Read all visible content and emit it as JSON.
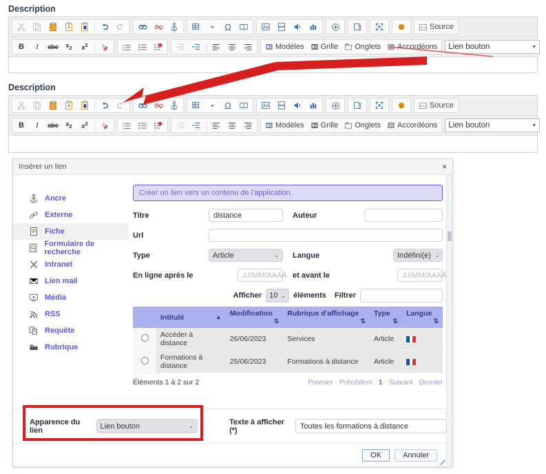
{
  "editors": [
    {
      "label": "Description"
    },
    {
      "label": "Description"
    }
  ],
  "toolbar": {
    "groups_row1": [
      {
        "icons": [
          {
            "name": "cut-icon",
            "glyph": "✂",
            "state": "dim"
          },
          {
            "name": "copy-icon",
            "glyph": "⧉",
            "state": "dim"
          },
          {
            "name": "paste-icon",
            "glyph": "📋",
            "state": "on"
          },
          {
            "name": "paste-text-icon",
            "glyph": "A",
            "state": "on"
          },
          {
            "name": "paste-word-icon",
            "glyph": "W",
            "state": "on"
          },
          {
            "name": "separator",
            "glyph": "|",
            "state": "sep"
          },
          {
            "name": "undo-icon",
            "glyph": "↺",
            "state": "on"
          },
          {
            "name": "redo-icon",
            "glyph": "↻",
            "state": "dim"
          }
        ]
      },
      {
        "icons": [
          {
            "name": "link-icon",
            "glyph": "🔗",
            "state": "on"
          },
          {
            "name": "unlink-icon",
            "glyph": "⛓",
            "state": "red"
          },
          {
            "name": "anchor-icon",
            "glyph": "⚓",
            "state": "on"
          }
        ]
      },
      {
        "icons": [
          {
            "name": "table-icon",
            "glyph": "▦",
            "state": "on"
          },
          {
            "name": "special-char-icon",
            "glyph": "Ω",
            "state": "on"
          },
          {
            "name": "page-break-icon",
            "glyph": "📖",
            "state": "on"
          }
        ]
      },
      {
        "icons": [
          {
            "name": "image-icon",
            "glyph": "🖼",
            "state": "on"
          },
          {
            "name": "media-icon",
            "glyph": "🎞",
            "state": "on"
          },
          {
            "name": "audio-icon",
            "glyph": "🔊",
            "state": "on"
          },
          {
            "name": "chart-icon",
            "glyph": "📊",
            "state": "on"
          }
        ]
      },
      {
        "icons": [
          {
            "name": "insert-plus-icon",
            "glyph": "(+)",
            "state": "on"
          }
        ]
      },
      {
        "icons": [
          {
            "name": "document-icon",
            "glyph": "🗐",
            "state": "on"
          }
        ]
      },
      {
        "icons": [
          {
            "name": "maximize-icon",
            "glyph": "⤢",
            "state": "on"
          }
        ]
      },
      {
        "icons": [
          {
            "name": "smiley-icon",
            "glyph": "☺",
            "state": "on"
          }
        ]
      },
      {
        "icons": [
          {
            "name": "source-icon",
            "glyph": "</>",
            "state": "on",
            "label": "Source"
          }
        ]
      }
    ],
    "source_label": "Source",
    "groups_row2": [
      {
        "icons": [
          {
            "name": "bold-icon",
            "glyph": "B",
            "state": "on"
          },
          {
            "name": "italic-icon",
            "glyph": "I",
            "state": "on"
          },
          {
            "name": "strikethrough-icon",
            "glyph": "abc",
            "state": "on"
          },
          {
            "name": "subscript-icon",
            "glyph": "x₂",
            "state": "on"
          },
          {
            "name": "superscript-icon",
            "glyph": "x²",
            "state": "on"
          },
          {
            "name": "separator",
            "glyph": "|",
            "state": "sep"
          },
          {
            "name": "remove-format-icon",
            "glyph": "🧹",
            "state": "red"
          }
        ]
      },
      {
        "icons": [
          {
            "name": "numbered-list-icon",
            "glyph": "1≡",
            "state": "on"
          },
          {
            "name": "bulleted-list-icon",
            "glyph": "•≡",
            "state": "on"
          },
          {
            "name": "todo-list-icon",
            "glyph": "☑≡",
            "state": "on"
          }
        ]
      },
      {
        "icons": [
          {
            "name": "outdent-icon",
            "glyph": "⇤",
            "state": "dim"
          },
          {
            "name": "indent-icon",
            "glyph": "⇥",
            "state": "on"
          },
          {
            "name": "separator",
            "glyph": "|",
            "state": "sep"
          },
          {
            "name": "align-left-icon",
            "glyph": "≡",
            "state": "on"
          },
          {
            "name": "align-center-icon",
            "glyph": "≡",
            "state": "on"
          },
          {
            "name": "align-right-icon",
            "glyph": "≡",
            "state": "on"
          }
        ]
      }
    ],
    "text_buttons": [
      {
        "name": "templates-button",
        "icon": "templates-icon",
        "label": "Modèles"
      },
      {
        "name": "grid-button",
        "icon": "grid-icon",
        "label": "Grille"
      },
      {
        "name": "tabs-button",
        "icon": "tabs-icon",
        "label": "Onglets"
      },
      {
        "name": "accordions-button",
        "icon": "accordions-icon",
        "label": "Accordéons"
      }
    ],
    "style_select": "Lien bouton",
    "quote_icon": "❞"
  },
  "dialog": {
    "title": "Insérer un lien",
    "close_label": "×",
    "sidebar": [
      {
        "icon": "anchor-icon",
        "label": "Ancre",
        "active": false
      },
      {
        "icon": "external-link-icon",
        "label": "Externe",
        "active": false
      },
      {
        "icon": "file-icon",
        "label": "Fiche",
        "active": true
      },
      {
        "icon": "search-form-icon",
        "label": "Formulaire de recherche",
        "active": false
      },
      {
        "icon": "intranet-icon",
        "label": "Intranet",
        "active": false
      },
      {
        "icon": "mail-icon",
        "label": "Lien mail",
        "active": false
      },
      {
        "icon": "media-icon",
        "label": "Média",
        "active": false
      },
      {
        "icon": "rss-icon",
        "label": "RSS",
        "active": false
      },
      {
        "icon": "query-icon",
        "label": "Requête",
        "active": false
      },
      {
        "icon": "folder-icon",
        "label": "Rubrique",
        "active": false
      }
    ],
    "alert": "Créer un lien vers un contenu de l'application.",
    "form": {
      "titre_label": "Titre",
      "titre_value": "distance",
      "auteur_label": "Auteur",
      "auteur_value": "",
      "url_label": "Url",
      "url_value": "",
      "type_label": "Type",
      "type_value": "Article",
      "langue_label": "Langue",
      "langue_value": "Indéfini(e)",
      "online_after_label": "En ligne après le",
      "online_after_placeholder": "JJ/MM/AAAA",
      "before_label": "et avant le",
      "before_placeholder": "JJ/MM/AAAA"
    },
    "table_controls": {
      "show_label": "Afficher",
      "page_size": "10",
      "elements_label": "éléments",
      "filter_label": "Filtrer",
      "filter_value": ""
    },
    "table": {
      "columns": [
        "Intitulé",
        "Modification",
        "Rubrique d'affichage",
        "Type",
        "Langue"
      ],
      "sort_indicators": [
        "▲",
        "⇅",
        "⇅",
        "⇅",
        "⇅"
      ],
      "rows": [
        {
          "selected": false,
          "intitule": "Accéder à distance",
          "modification": "26/06/2023",
          "rubrique": "Services",
          "type": "Article",
          "langue": "fr"
        },
        {
          "selected": false,
          "intitule": "Formations à distance",
          "modification": "25/06/2023",
          "rubrique": "Formations à distance",
          "type": "Article",
          "langue": "fr"
        }
      ]
    },
    "pager": {
      "summary": "Éléments 1 à 2 sur 2",
      "first": "Premier",
      "prev": "Précédent",
      "current": "1",
      "next": "Suivant",
      "last": "Dernier"
    },
    "appearance": {
      "label": "Apparence du lien",
      "value": "Lien bouton",
      "text_label": "Texte à afficher (*)",
      "text_value": "Toutes les formations à distance"
    },
    "footer": {
      "ok": "OK",
      "cancel": "Annuler"
    }
  },
  "annotations": {
    "arrow_color": "#d81f1f",
    "highlight_color": "#d81f1f"
  }
}
